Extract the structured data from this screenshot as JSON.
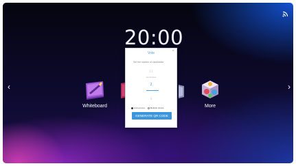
{
  "clock": {
    "time": "20:00"
  },
  "apps": [
    {
      "label": "Whiteboard",
      "icon": "whiteboard-icon"
    },
    {
      "label": "More",
      "icon": "more-apps-icon"
    }
  ],
  "status": {
    "cast_icon": "screen-cast-icon"
  },
  "dialog": {
    "title": "Vote",
    "close": "×",
    "prompt": "Set the number of candidates",
    "picker": {
      "above": "11",
      "label": "Candidates",
      "selected": "2",
      "below": "3"
    },
    "options": [
      {
        "label": "Anonymous",
        "checked": true
      },
      {
        "label": "Multiple choice",
        "checked": false
      }
    ],
    "generate_button": "GENERATE QR CODE"
  },
  "nav": {
    "left": "‹",
    "right": "›"
  },
  "colors": {
    "accent": "#3d96dc",
    "title": "#5aa1e0"
  }
}
